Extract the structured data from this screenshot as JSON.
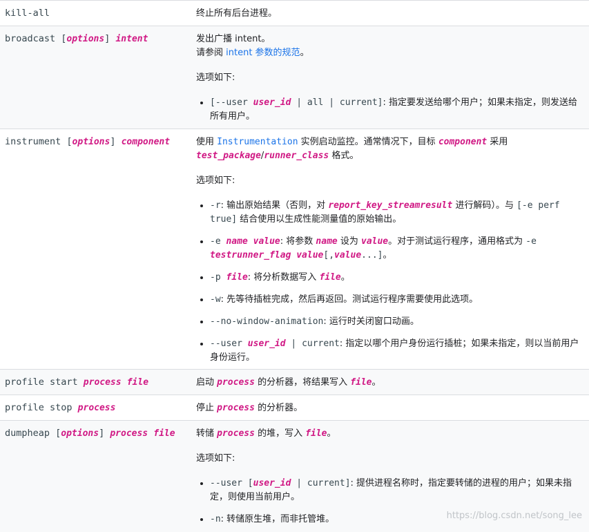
{
  "rows": [
    {
      "cmd": "kill-all",
      "desc": "终止所有后台进程。"
    },
    {
      "cmd": {
        "name": "broadcast [",
        "opt": "options",
        "mid": "] ",
        "arg": "intent"
      },
      "desc": {
        "line1": "发出广播 intent。",
        "line2_prefix": "请参阅 ",
        "line2_link": "intent 参数的规范",
        "line2_suffix": "。",
        "options_title": "选项如下:",
        "items": [
          {
            "code1": "[--user ",
            "var1": "user_id",
            "code2": " | all | current]",
            "text": ": 指定要发送给哪个用户；如果未指定，则发送给所有用户。"
          }
        ]
      }
    },
    {
      "cmd": {
        "name": "instrument [",
        "opt": "options",
        "mid": "] ",
        "arg": "component"
      },
      "desc": {
        "p1_a": "使用 ",
        "p1_link": "Instrumentation",
        "p1_b": " 实例启动监控。通常情况下，目标 ",
        "p1_var1": "component",
        "p1_c": " 采用 ",
        "p1_var2": "test_package",
        "p1_d": "/",
        "p1_var3": "runner_class",
        "p1_e": " 格式。",
        "options_title": "选项如下:",
        "item_r": {
          "code": "-r",
          "t1": ": 输出原始结果（否则，对 ",
          "var": "report_key_streamresult",
          "t2": " 进行解码）。与 ",
          "code2": "[-e perf true]",
          "t3": " 结合使用以生成性能测量值的原始输出。"
        },
        "item_e": {
          "code": "-e ",
          "var1": "name",
          "sp": " ",
          "var2": "value",
          "t1": ": 将参数 ",
          "var3": "name",
          "t2": " 设为 ",
          "var4": "value",
          "t3": "。对于测试运行程序，通用格式为 ",
          "code2": "-e ",
          "var5": "testrunner_flag",
          "sp2": " ",
          "var6": "value",
          "code3": "[,",
          "var7": "value",
          "code4": "...]",
          "t4": "。"
        },
        "item_p": {
          "code": "-p ",
          "var1": "file",
          "t1": ": 将分析数据写入 ",
          "var2": "file",
          "t2": "。"
        },
        "item_w": {
          "code": "-w",
          "t1": ": 先等待插桩完成，然后再返回。测试运行程序需要使用此选项。"
        },
        "item_nwa": {
          "code": "--no-window-animation",
          "t1": ": 运行时关闭窗口动画。"
        },
        "item_user": {
          "code": "--user ",
          "var1": "user_id",
          "code2": " | current",
          "t1": ": 指定以哪个用户身份运行插桩；如果未指定，则以当前用户身份运行。"
        }
      }
    },
    {
      "cmd": {
        "name": "profile start ",
        "arg1": "process",
        "sp": " ",
        "arg2": "file"
      },
      "desc": {
        "t1": "启动 ",
        "var1": "process",
        "t2": " 的分析器，将结果写入 ",
        "var2": "file",
        "t3": "。"
      }
    },
    {
      "cmd": {
        "name": "profile stop ",
        "arg1": "process"
      },
      "desc": {
        "t1": "停止 ",
        "var1": "process",
        "t2": " 的分析器。"
      }
    },
    {
      "cmd": {
        "name": "dumpheap [",
        "opt": "options",
        "mid": "] ",
        "arg1": "process",
        "sp": " ",
        "arg2": "file"
      },
      "desc": {
        "t1": "转储 ",
        "var1": "process",
        "t2": " 的堆，写入 ",
        "var2": "file",
        "t3": "。",
        "options_title": "选项如下:",
        "item_user": {
          "code": "--user [",
          "var1": "user_id",
          "code2": " | current]",
          "t1": ": 提供进程名称时，指定要转储的进程的用户；如果未指定，则使用当前用户。"
        },
        "item_n": {
          "code": "-n",
          "t1": ": 转储原生堆，而非托管堆。"
        }
      }
    }
  ],
  "watermark": "https://blog.csdn.net/song_lee"
}
